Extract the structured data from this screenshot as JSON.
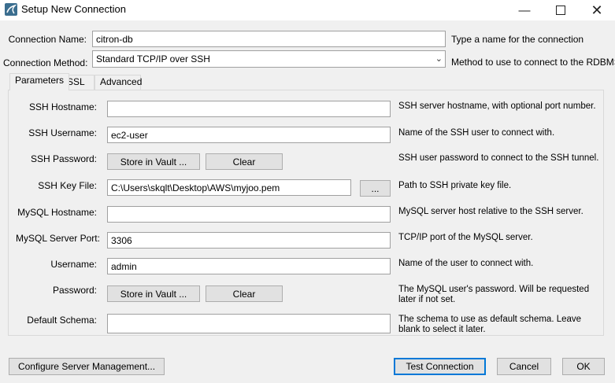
{
  "window": {
    "title": "Setup New Connection"
  },
  "header": {
    "connection_name_label": "Connection Name:",
    "connection_name_value": "citron-db",
    "connection_name_hint": "Type a name for the connection",
    "connection_method_label": "Connection Method:",
    "connection_method_value": "Standard TCP/IP over SSH",
    "connection_method_hint": "Method to use to connect to the RDBMS"
  },
  "tabs": [
    {
      "label": "Parameters",
      "active": true
    },
    {
      "label": "SSL",
      "active": false
    },
    {
      "label": "Advanced",
      "active": false
    }
  ],
  "params": {
    "ssh_hostname_label": "SSH Hostname:",
    "ssh_hostname_value": "",
    "ssh_hostname_hint": "SSH server hostname, with  optional port number.",
    "ssh_username_label": "SSH Username:",
    "ssh_username_value": "ec2-user",
    "ssh_username_hint": "Name of the SSH user to connect with.",
    "ssh_password_label": "SSH Password:",
    "ssh_password_hint": "SSH user password to connect to the SSH tunnel.",
    "ssh_keyfile_label": "SSH Key File:",
    "ssh_keyfile_value": "C:\\Users\\skqlt\\Desktop\\AWS\\myjoo.pem",
    "ssh_keyfile_browse": "...",
    "ssh_keyfile_hint": "Path to SSH private key file.",
    "mysql_hostname_label": "MySQL Hostname:",
    "mysql_hostname_value": "",
    "mysql_hostname_hint": "MySQL server host relative to the SSH server.",
    "mysql_port_label": "MySQL Server Port:",
    "mysql_port_value": "3306",
    "mysql_port_hint": "TCP/IP port of the MySQL server.",
    "username_label": "Username:",
    "username_value": "admin",
    "username_hint": "Name of the user to connect with.",
    "password_label": "Password:",
    "password_hint_1": "The MySQL user's password. Will be requested",
    "password_hint_2": "later if not set.",
    "schema_label": "Default Schema:",
    "schema_value": "",
    "schema_hint_1": "The schema to use as default schema. Leave",
    "schema_hint_2": "blank to select it later.",
    "store_in_vault": "Store in Vault ...",
    "clear": "Clear"
  },
  "footer": {
    "configure_server": "Configure Server Management...",
    "test_connection": "Test Connection",
    "cancel": "Cancel",
    "ok": "OK"
  },
  "colors": {
    "window_bg": "#f0f0f0",
    "titlebar_bg": "#ffffff",
    "default_button_border": "#0078d7"
  }
}
